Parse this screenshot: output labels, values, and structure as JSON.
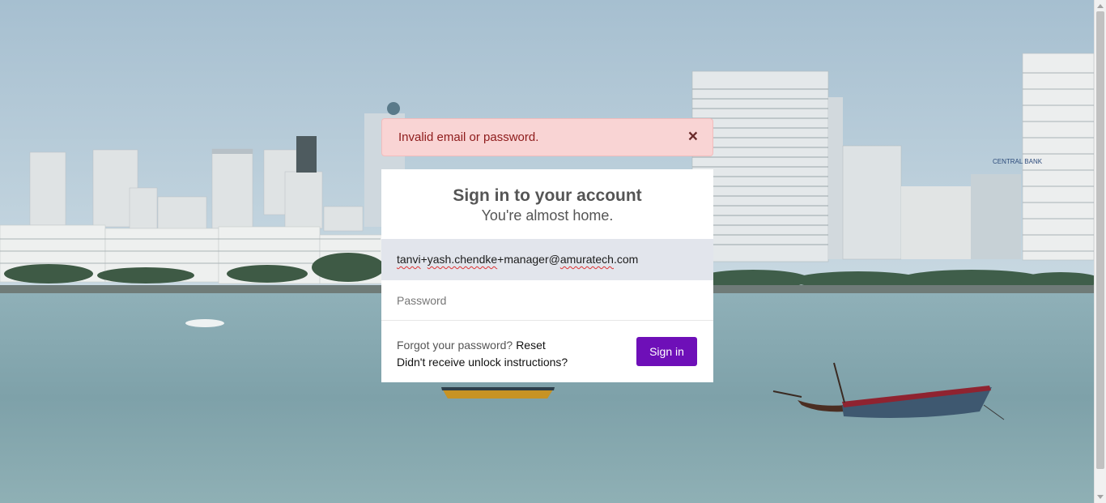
{
  "alert": {
    "message": "Invalid email or password.",
    "close_glyph": "×"
  },
  "login": {
    "title": "Sign in to your account",
    "subtitle": "You're almost home.",
    "email_value": "tanvi+yash.chendke+manager@amuratech.com",
    "email_parts": [
      "tanvi",
      "+",
      "yash.chendke",
      "+manager@",
      "amuratech",
      ".com"
    ],
    "password_placeholder": "Password",
    "forgot_text": "Forgot your password?",
    "reset_label": "Reset",
    "unlock_label": "Didn't receive unlock instructions?",
    "signin_label": "Sign in"
  },
  "background": {
    "description_icon": "city-skyline-bay-background",
    "bank_sign": "CENTRAL BANK"
  },
  "colors": {
    "button": "#6e0fb8",
    "alert_bg": "#f9d4d4",
    "alert_text": "#8e1b1b",
    "email_bg": "#e2e5ec"
  }
}
